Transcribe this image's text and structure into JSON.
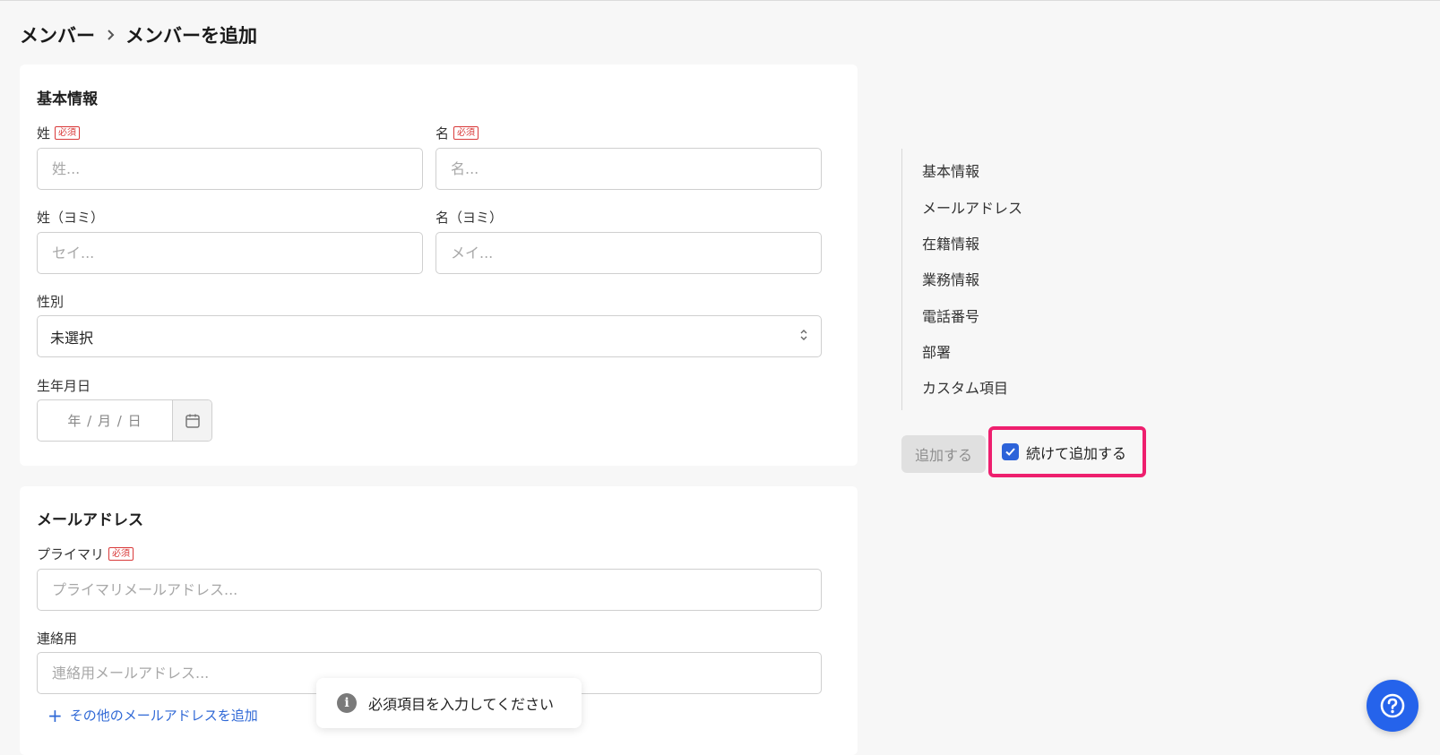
{
  "breadcrumb": {
    "parent": "メンバー",
    "current": "メンバーを追加"
  },
  "basic_info": {
    "title": "基本情報",
    "required_badge": "必須",
    "last_name": {
      "label": "姓",
      "placeholder": "姓..."
    },
    "first_name": {
      "label": "名",
      "placeholder": "名..."
    },
    "last_name_kana": {
      "label": "姓（ヨミ）",
      "placeholder": "セイ..."
    },
    "first_name_kana": {
      "label": "名（ヨミ）",
      "placeholder": "メイ..."
    },
    "gender": {
      "label": "性別",
      "value": "未選択"
    },
    "birthday": {
      "label": "生年月日",
      "placeholder": "年 / 月 / 日"
    }
  },
  "email": {
    "title": "メールアドレス",
    "primary": {
      "label": "プライマリ",
      "placeholder": "プライマリメールアドレス..."
    },
    "contact": {
      "label": "連絡用",
      "placeholder": "連絡用メールアドレス..."
    },
    "add_more": "その他のメールアドレスを追加"
  },
  "toc": [
    "基本情報",
    "メールアドレス",
    "在籍情報",
    "業務情報",
    "電話番号",
    "部署",
    "カスタム項目"
  ],
  "actions": {
    "submit": "追加する",
    "continue_label": "続けて追加する",
    "continue_checked": true
  },
  "toast": {
    "message": "必須項目を入力してください"
  },
  "colors": {
    "accent": "#2d63d9",
    "required": "#d93a3a",
    "highlight": "#ee1f6e",
    "link": "#2f68d6",
    "fab": "#2563eb"
  }
}
